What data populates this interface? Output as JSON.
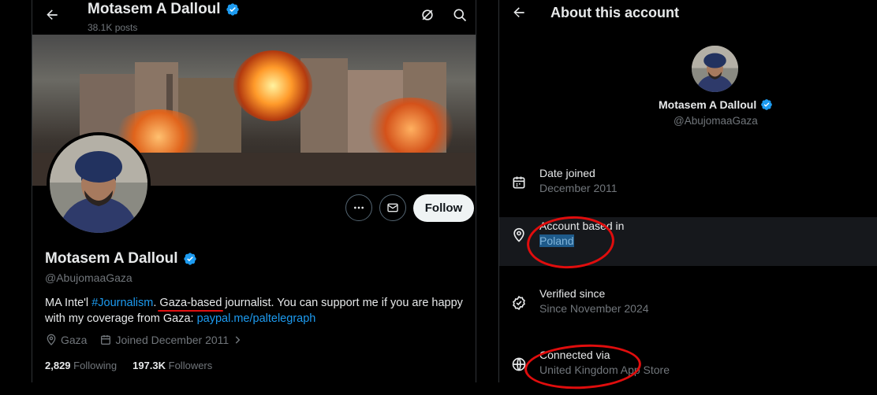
{
  "left": {
    "header": {
      "name": "Motasem A Dalloul",
      "posts_count": "38.1K posts"
    },
    "profile": {
      "name": "Motasem A Dalloul",
      "handle": "@AbujomaaGaza",
      "bio_prefix": "MA Inte'l ",
      "bio_hashtag": "#Journalism",
      "bio_sep": ". ",
      "bio_gaza": "Gaza-based",
      "bio_middle": " journalist. You can support me if you are happy with my coverage from Gaza: ",
      "bio_link": "paypal.me/paltelegraph",
      "location": "Gaza",
      "joined": "Joined December 2011",
      "following_count": "2,829",
      "following_label": "Following",
      "followers_count": "197.3K",
      "followers_label": "Followers"
    },
    "actions": {
      "follow_label": "Follow"
    }
  },
  "right": {
    "title": "About this account",
    "name": "Motasem A Dalloul",
    "handle": "@AbujomaaGaza",
    "rows": [
      {
        "label": "Date joined",
        "value": "December 2011",
        "icon": "calendar-icon"
      },
      {
        "label": "Account based in",
        "value": "Poland",
        "icon": "location-pin-icon"
      },
      {
        "label": "Verified since",
        "value": "Since November 2024",
        "icon": "verified-check-icon"
      },
      {
        "label": "Connected via",
        "value": "United Kingdom App Store",
        "icon": "globe-icon"
      }
    ]
  },
  "colors": {
    "background": "#000000",
    "accent": "#1d9bf0",
    "annotation_red": "#e00d0d",
    "muted_text": "#71767b"
  }
}
